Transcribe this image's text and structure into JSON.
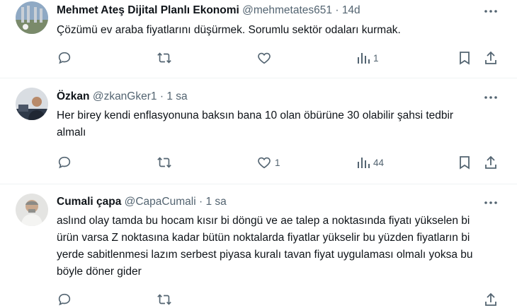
{
  "tweets": [
    {
      "name": "Mehmet Ateş Dijital Planlı Ekonomi",
      "handle": "@mehmetates651",
      "separator": "·",
      "time": "14d",
      "text": "Çözümü ev araba fiyatlarını düşürmek. Sorumlu sektör odaları kurmak.",
      "counts": {
        "reply": "",
        "retweet": "",
        "like": "",
        "views": "1"
      }
    },
    {
      "name": "Özkan",
      "handle": "@zkanGker1",
      "separator": "·",
      "time": "1 sa",
      "text": "Her birey kendi enflasyonuna baksın bana 10 olan öbürüne 30 olabilir şahsi tedbir almalı",
      "counts": {
        "reply": "",
        "retweet": "",
        "like": "1",
        "views": "44"
      }
    },
    {
      "name": "Cumali çapa",
      "handle": "@CapaCumali",
      "separator": "·",
      "time": "1 sa",
      "text": "aslınd olay tamda bu hocam kısır bi döngü ve ae talep a noktasında fiyatı yükselen bi ürün varsa Z noktasına kadar bütün noktalarda fiyatlar yükselir bu yüzden fiyatların bi yerde sabitlenmesi lazım serbest piyasa kuralı tavan fiyat uygulaması olmalı yoksa bu böyle döner gider",
      "counts": {
        "reply": "",
        "retweet": "",
        "like": "",
        "views": ""
      }
    }
  ],
  "icons": {
    "reply": "reply-icon",
    "retweet": "retweet-icon",
    "like": "like-icon",
    "views": "views-icon",
    "bookmark": "bookmark-icon",
    "share": "share-icon",
    "more": "more-icon"
  },
  "colors": {
    "text": "#0f1419",
    "secondary": "#536471",
    "divider": "#eff3f4"
  }
}
